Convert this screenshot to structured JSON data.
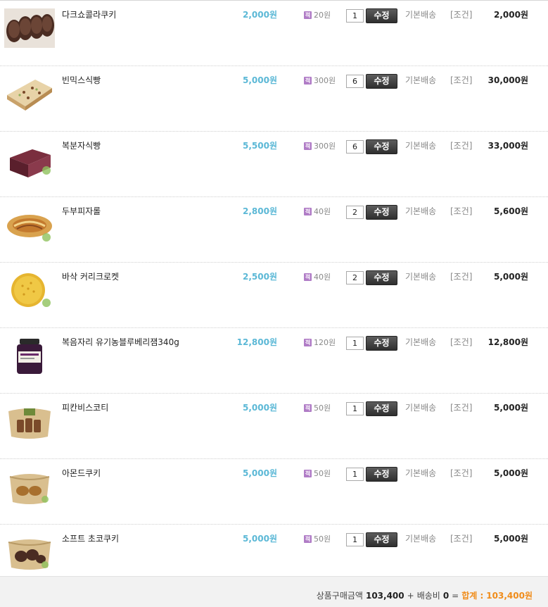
{
  "cart": {
    "items": [
      {
        "name": "다크쇼콜라쿠키",
        "price": "2,000원",
        "point": "20원",
        "qty": "1",
        "edit_label": "수정",
        "shipping": "기본배송",
        "condition": "[조건]",
        "subtotal": "2,000원",
        "image": "dark-chocolate-cookie-image"
      },
      {
        "name": "빈믹스식빵",
        "price": "5,000원",
        "point": "300원",
        "qty": "6",
        "edit_label": "수정",
        "shipping": "기본배송",
        "condition": "[조건]",
        "subtotal": "30,000원",
        "image": "bean-mix-bread-image"
      },
      {
        "name": "복분자식빵",
        "price": "5,500원",
        "point": "300원",
        "qty": "6",
        "edit_label": "수정",
        "shipping": "기본배송",
        "condition": "[조건]",
        "subtotal": "33,000원",
        "image": "raspberry-bread-image"
      },
      {
        "name": "두부피자롤",
        "price": "2,800원",
        "point": "40원",
        "qty": "2",
        "edit_label": "수정",
        "shipping": "기본배송",
        "condition": "[조건]",
        "subtotal": "5,600원",
        "image": "tofu-pizza-roll-image"
      },
      {
        "name": "바삭 커리크로켓",
        "price": "2,500원",
        "point": "40원",
        "qty": "2",
        "edit_label": "수정",
        "shipping": "기본배송",
        "condition": "[조건]",
        "subtotal": "5,000원",
        "image": "curry-croquette-image"
      },
      {
        "name": "복음자리 유기농블루베리잼340g",
        "price": "12,800원",
        "point": "120원",
        "qty": "1",
        "edit_label": "수정",
        "shipping": "기본배송",
        "condition": "[조건]",
        "subtotal": "12,800원",
        "image": "blueberry-jam-image"
      },
      {
        "name": "피칸비스코티",
        "price": "5,000원",
        "point": "50원",
        "qty": "1",
        "edit_label": "수정",
        "shipping": "기본배송",
        "condition": "[조건]",
        "subtotal": "5,000원",
        "image": "pecan-biscotti-image"
      },
      {
        "name": "아몬드쿠키",
        "price": "5,000원",
        "point": "50원",
        "qty": "1",
        "edit_label": "수정",
        "shipping": "기본배송",
        "condition": "[조건]",
        "subtotal": "5,000원",
        "image": "almond-cookie-image"
      },
      {
        "name": "소프트 초코쿠키",
        "price": "5,000원",
        "point": "50원",
        "qty": "1",
        "edit_label": "수정",
        "shipping": "기본배송",
        "condition": "[조건]",
        "subtotal": "5,000원",
        "image": "soft-choco-cookie-image"
      }
    ],
    "point_icon_glyph": "적",
    "summary": {
      "product_total_label": "상품구매금액",
      "product_total": "103,400",
      "plus": "+",
      "shipping_label": "배송비",
      "shipping_fee": "0",
      "equals": "=",
      "total_label": "합계 :",
      "total": "103,400원"
    },
    "colors": {
      "price": "#5bb8d6",
      "total": "#f08c1a",
      "point_icon": "#b07cc6"
    }
  }
}
